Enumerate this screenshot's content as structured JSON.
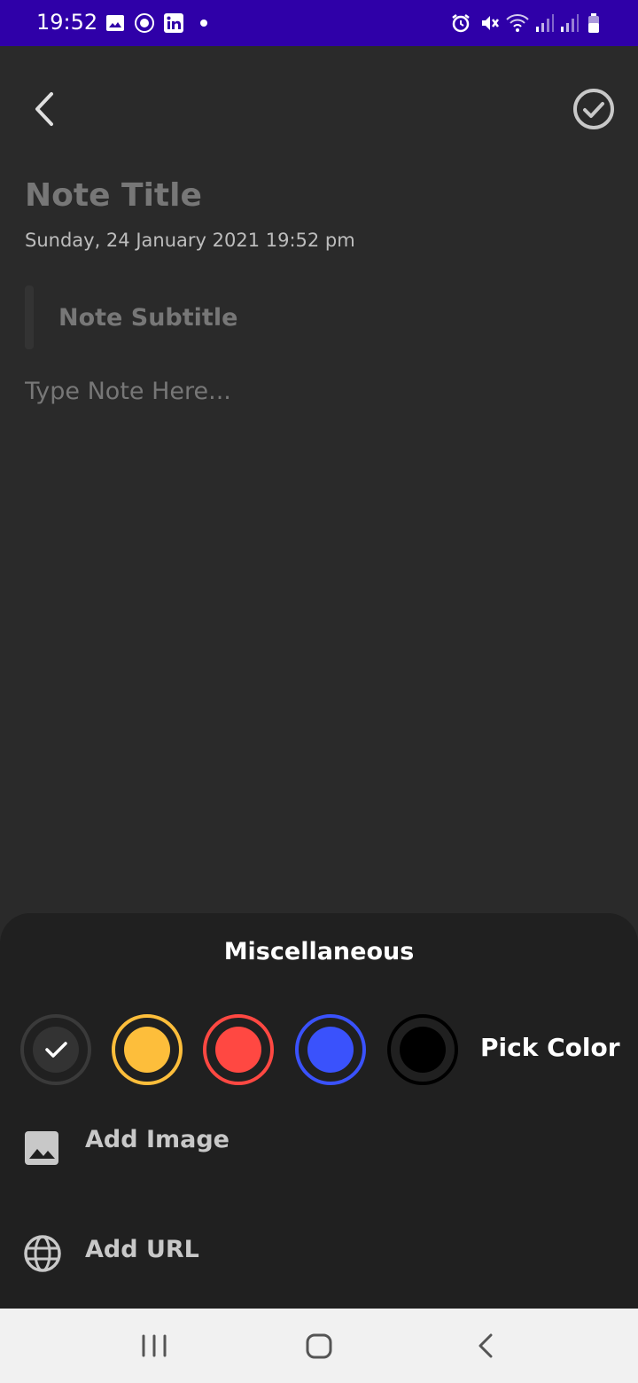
{
  "status_bar": {
    "time": "19:52",
    "color": "#2f00a8",
    "left_icons": [
      "gallery-icon",
      "club-badge-icon",
      "linkedin-icon",
      "dot-icon"
    ],
    "right_icons": [
      "alarm-icon",
      "vibrate-mute-icon",
      "wifi-icon",
      "signal-icon",
      "signal-icon",
      "battery-icon"
    ]
  },
  "toolbar": {
    "back_icon": "back-arrow-icon",
    "done_icon": "check-circle-icon"
  },
  "note": {
    "title_placeholder": "Note Title",
    "date_time": "Sunday, 24 January 2021 19:52 pm",
    "subtitle_placeholder": "Note Subtitle",
    "body_placeholder": "Type Note Here..."
  },
  "misc_sheet": {
    "title": "Miscellaneous",
    "colors": [
      {
        "name": "default",
        "hex": "#333333",
        "selected": true
      },
      {
        "name": "yellow",
        "hex": "#fdbe3b",
        "selected": false
      },
      {
        "name": "red",
        "hex": "#ff4842",
        "selected": false
      },
      {
        "name": "blue",
        "hex": "#3a52fc",
        "selected": false
      },
      {
        "name": "black",
        "hex": "#000000",
        "selected": false
      }
    ],
    "pick_color_label": "Pick Color",
    "add_image_label": "Add Image",
    "add_url_label": "Add URL"
  },
  "nav_bar": {
    "recents_icon": "recents-icon",
    "home_icon": "home-icon",
    "back_icon": "nav-back-icon"
  }
}
